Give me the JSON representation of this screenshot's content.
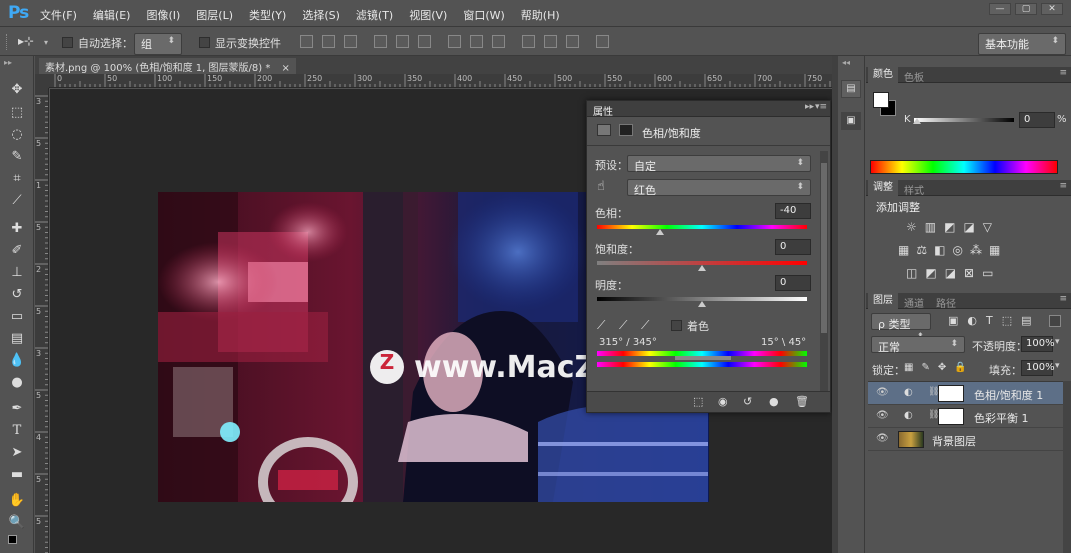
{
  "app": {
    "logo": "Ps"
  },
  "menu": [
    "文件(F)",
    "编辑(E)",
    "图像(I)",
    "图层(L)",
    "类型(Y)",
    "选择(S)",
    "滤镜(T)",
    "视图(V)",
    "窗口(W)",
    "帮助(H)"
  ],
  "window_controls": [
    "—",
    "▢",
    "✕"
  ],
  "options": {
    "move_tool_glyph": "▸⊹",
    "auto_select_label": "自动选择：",
    "auto_select_value": "组",
    "show_transform_label": "显示变换控件",
    "workspace": "基本功能"
  },
  "document_tab": {
    "title": "素材.png @ 100% (色相/饱和度 1, 图层蒙版/8) *",
    "close": "×"
  },
  "rulers": {
    "top": [
      "0",
      "50",
      "100",
      "150",
      "200",
      "250",
      "300",
      "350",
      "400",
      "450",
      "500",
      "550",
      "600",
      "650",
      "700",
      "750"
    ],
    "left": [
      "3",
      "5",
      "1",
      "5",
      "2",
      "5",
      "3",
      "5",
      "4",
      "5",
      "5"
    ]
  },
  "watermark": {
    "text": "www.MacZ.com",
    "logo_letter": "Z"
  },
  "properties": {
    "tab": "属性",
    "title": "色相/饱和度",
    "preset_label": "预设：",
    "preset_value": "自定",
    "channel_value": "红色",
    "hue_label": "色相：",
    "hue_value": "-40",
    "hue_level": 0.3,
    "saturation_label": "饱和度：",
    "saturation_value": "0",
    "saturation_level": 0.5,
    "lightness_label": "明度：",
    "lightness_value": "0",
    "lightness_level": 0.5,
    "colorize_label": "着色",
    "range_left": "315° / 345°",
    "range_right": "15° \\ 45°"
  },
  "color_panel": {
    "tabs": [
      "颜色",
      "色板"
    ],
    "k_label": "K",
    "k_value": "0",
    "k_unit": "%"
  },
  "adjustments_panel": {
    "tabs": [
      "调整",
      "样式"
    ],
    "title": "添加调整"
  },
  "layers_panel": {
    "tabs": [
      "图层",
      "通道",
      "路径"
    ],
    "kind_filter": "ρ 类型",
    "blend_mode": "正常",
    "opacity_label": "不透明度：",
    "opacity_value": "100%",
    "lock_label": "锁定：",
    "fill_label": "填充：",
    "fill_value": "100%",
    "layers": [
      {
        "name": "色相/饱和度 1",
        "selected": true
      },
      {
        "name": "色彩平衡 1",
        "selected": false
      },
      {
        "name": "背景图层",
        "selected": false
      }
    ]
  },
  "colors": {
    "ps_blue": "#3fa9f5",
    "panel": "#535353",
    "canvas": "#282828",
    "selected_layer": "#5d6f87"
  }
}
